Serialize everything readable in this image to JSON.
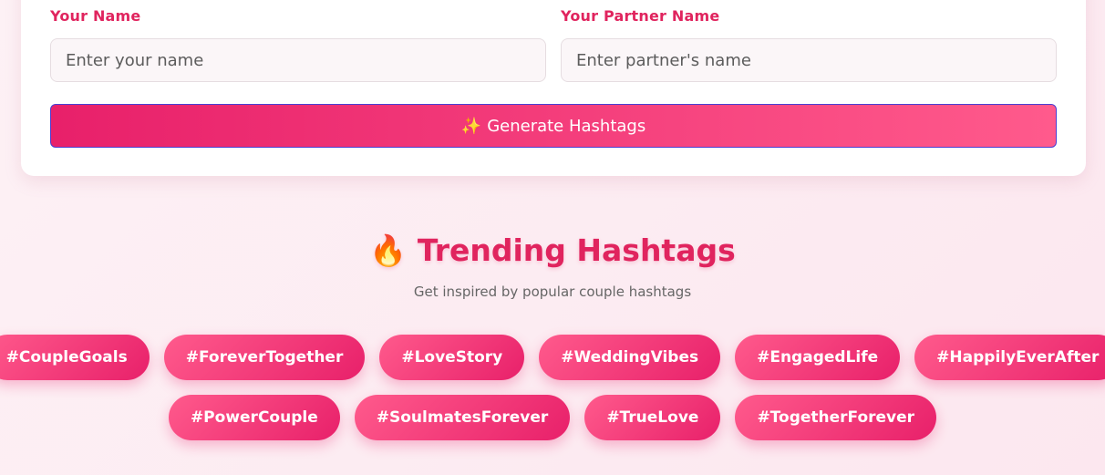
{
  "form": {
    "your_name": {
      "label": "Your Name",
      "placeholder": "Enter your name",
      "value": ""
    },
    "partner_name": {
      "label": "Your Partner Name",
      "placeholder": "Enter partner's name",
      "value": ""
    },
    "generate_button": {
      "icon": "sparkles-icon",
      "icon_glyph": "✨",
      "label": "Generate Hashtags"
    }
  },
  "trending": {
    "icon": "fire-icon",
    "icon_glyph": "🔥",
    "title": "Trending Hashtags",
    "subtitle": "Get inspired by popular couple hashtags",
    "tags": [
      "#CoupleGoals",
      "#ForeverTogether",
      "#LoveStory",
      "#WeddingVibes",
      "#EngagedLife",
      "#HappilyEverAfter",
      "#PowerCouple",
      "#SoulmatesForever",
      "#TrueLove",
      "#TogetherForever"
    ]
  },
  "colors": {
    "accent": "#e0245e",
    "gradient_start": "#e8206a",
    "gradient_end": "#ff5a8c",
    "background": "#fdf1f5"
  }
}
